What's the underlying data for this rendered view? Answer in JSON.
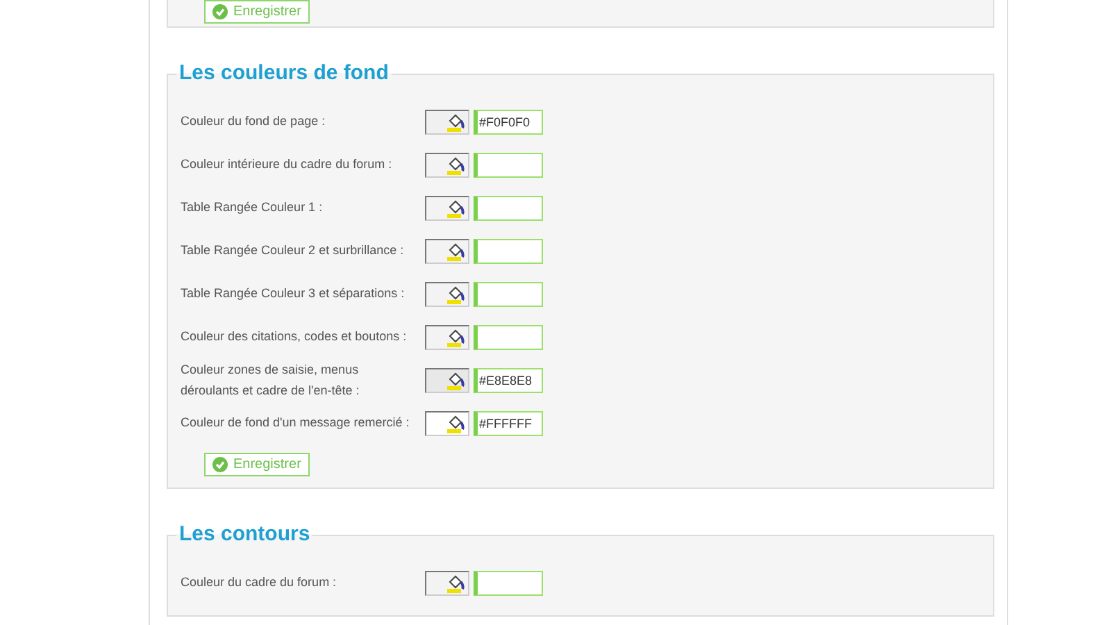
{
  "top_section": {
    "save_button": "Enregistrer"
  },
  "sections": [
    {
      "title": "Les couleurs de fond",
      "rows": [
        {
          "label": "Couleur du fond de page  :",
          "value": "#F0F0F0"
        },
        {
          "label": "Couleur intérieure du cadre du forum  :",
          "value": ""
        },
        {
          "label": "Table Rangée Couleur 1  :",
          "value": ""
        },
        {
          "label": "Table Rangée Couleur 2 et surbrillance  :",
          "value": ""
        },
        {
          "label": "Table Rangée Couleur 3 et séparations  :",
          "value": ""
        },
        {
          "label": "Couleur des citations, codes et boutons  :",
          "value": ""
        },
        {
          "label": "Couleur zones de saisie, menus déroulants et cadre de l'en-tête  :",
          "value": "#E8E8E8"
        },
        {
          "label": "Couleur de fond d'un message remercié  :",
          "value": "#FFFFFF"
        }
      ],
      "save_button": "Enregistrer"
    },
    {
      "title": "Les contours",
      "rows": [
        {
          "label": "Couleur du cadre du forum  :",
          "value": ""
        }
      ]
    }
  ]
}
